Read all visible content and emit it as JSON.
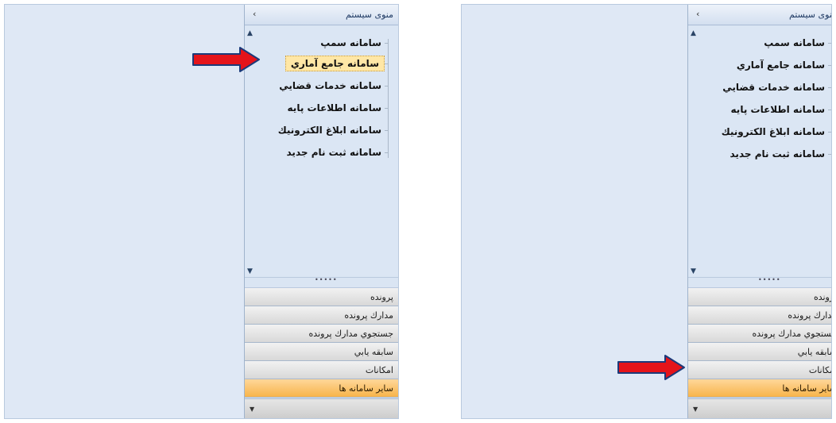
{
  "menu": {
    "title": "منوی سیستم",
    "collapse_glyph": "‹",
    "scroll_up_glyph": "▲",
    "scroll_down_glyph": "▼",
    "splitter_dots": "•••••",
    "overflow_glyph": "▼",
    "tree_items": [
      "سامانه سمپ",
      "سامانه جامع آماري",
      "سامانه خدمات قضايي",
      "سامانه اطلاعات پايه",
      "سامانه ابلاغ الكترونيك",
      "سامانه ثبت نام جديد"
    ],
    "nav_buttons": [
      "پرونده",
      "مدارك پرونده",
      "جستجوي مدارك پرونده",
      "سابقه يابي",
      "امكانات",
      "ساير سامانه ها"
    ]
  },
  "colors": {
    "panel_bg": "#dae5f3",
    "screen_bg": "#dfe8f5",
    "active_nav": "#f7b44a",
    "selected_item": "#ffe7a6",
    "arrow_red": "#e5141a"
  },
  "annotations": {
    "left_arrow_target": "tree-item-2",
    "right_arrow_target": "nav-button-6"
  }
}
